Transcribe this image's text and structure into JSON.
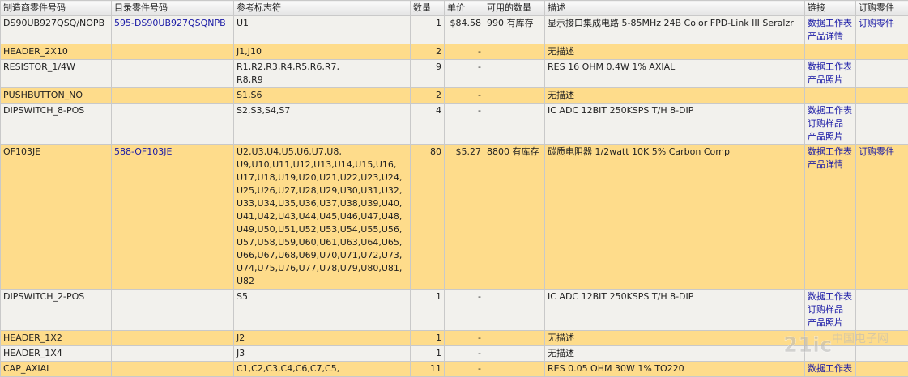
{
  "headers": [
    "制造商零件号码",
    "目录零件号码",
    "参考标志符",
    "数量",
    "单价",
    "可用的数量",
    "描述",
    "链接",
    "订购零件"
  ],
  "rows": [
    {
      "style": "grey",
      "mfr": "DS90UB927QSQ/NOPB",
      "cat": "595-DS90UB927QSQNPB",
      "refs": [
        "U1"
      ],
      "qty": "1",
      "price": "$84.58",
      "avail": "990 有库存",
      "desc": "显示接口集成电路 5-85MHz 24B Color FPD-Link III Seralzr",
      "links": [
        "数据工作表",
        "产品详情"
      ],
      "order": "订购零件"
    },
    {
      "style": "yellow",
      "mfr": "HEADER_2X10",
      "cat": "",
      "refs": [
        "J1,J10"
      ],
      "qty": "2",
      "price": "-",
      "avail": "",
      "desc": "无描述",
      "links": [],
      "order": ""
    },
    {
      "style": "grey",
      "mfr": "RESISTOR_1/4W",
      "cat": "",
      "refs": [
        "R1,R2,R3,R4,R5,R6,R7,",
        "R8,R9"
      ],
      "qty": "9",
      "price": "-",
      "avail": "",
      "desc": "RES 16 OHM 0.4W 1% AXIAL",
      "links": [
        "数据工作表",
        "产品照片"
      ],
      "order": ""
    },
    {
      "style": "yellow",
      "mfr": "PUSHBUTTON_NO",
      "cat": "",
      "refs": [
        "S1,S6"
      ],
      "qty": "2",
      "price": "-",
      "avail": "",
      "desc": "无描述",
      "links": [],
      "order": ""
    },
    {
      "style": "grey",
      "mfr": "DIPSWITCH_8-POS",
      "cat": "",
      "refs": [
        "S2,S3,S4,S7"
      ],
      "qty": "4",
      "price": "-",
      "avail": "",
      "desc": "IC ADC 12BIT 250KSPS T/H 8-DIP",
      "links": [
        "数据工作表",
        "订购样品",
        "产品照片"
      ],
      "order": ""
    },
    {
      "style": "yellow",
      "mfr": "OF103JE",
      "cat": "588-OF103JE",
      "refs": [
        "U2,U3,U4,U5,U6,U7,U8,",
        "U9,U10,U11,U12,U13,U14,U15,U16,",
        "U17,U18,U19,U20,U21,U22,U23,U24,",
        "U25,U26,U27,U28,U29,U30,U31,U32,",
        "U33,U34,U35,U36,U37,U38,U39,U40,",
        "U41,U42,U43,U44,U45,U46,U47,U48,",
        "U49,U50,U51,U52,U53,U54,U55,U56,",
        "U57,U58,U59,U60,U61,U63,U64,U65,",
        "U66,U67,U68,U69,U70,U71,U72,U73,",
        "U74,U75,U76,U77,U78,U79,U80,U81,",
        "U82"
      ],
      "qty": "80",
      "price": "$5.27",
      "avail": "8800 有库存",
      "desc": "碳质电阻器 1/2watt 10K 5% Carbon Comp",
      "links": [
        "数据工作表",
        "产品详情"
      ],
      "order": "订购零件"
    },
    {
      "style": "grey",
      "mfr": "DIPSWITCH_2-POS",
      "cat": "",
      "refs": [
        "S5"
      ],
      "qty": "1",
      "price": "-",
      "avail": "",
      "desc": "IC ADC 12BIT 250KSPS T/H 8-DIP",
      "links": [
        "数据工作表",
        "订购样品",
        "产品照片"
      ],
      "order": ""
    },
    {
      "style": "yellow",
      "mfr": "HEADER_1X2",
      "cat": "",
      "refs": [
        "J2"
      ],
      "qty": "1",
      "price": "-",
      "avail": "",
      "desc": "无描述",
      "links": [],
      "order": ""
    },
    {
      "style": "grey",
      "mfr": "HEADER_1X4",
      "cat": "",
      "refs": [
        "J3"
      ],
      "qty": "1",
      "price": "-",
      "avail": "",
      "desc": "无描述",
      "links": [],
      "order": ""
    },
    {
      "style": "yellow",
      "mfr": "CAP_AXIAL",
      "cat": "",
      "refs": [
        "C1,C2,C3,C4,C6,C7,C5,"
      ],
      "qty": "11",
      "price": "-",
      "avail": "",
      "desc": "RES 0.05 OHM 30W 1% TO220",
      "links": [
        "数据工作表"
      ],
      "order": ""
    }
  ],
  "watermark": {
    "logo_text": "21ic",
    "site_text": "中国电子网"
  },
  "colors": {
    "row_grey": "#f2f1ed",
    "row_yellow": "#fedc8b",
    "link": "#1a1aa6"
  }
}
